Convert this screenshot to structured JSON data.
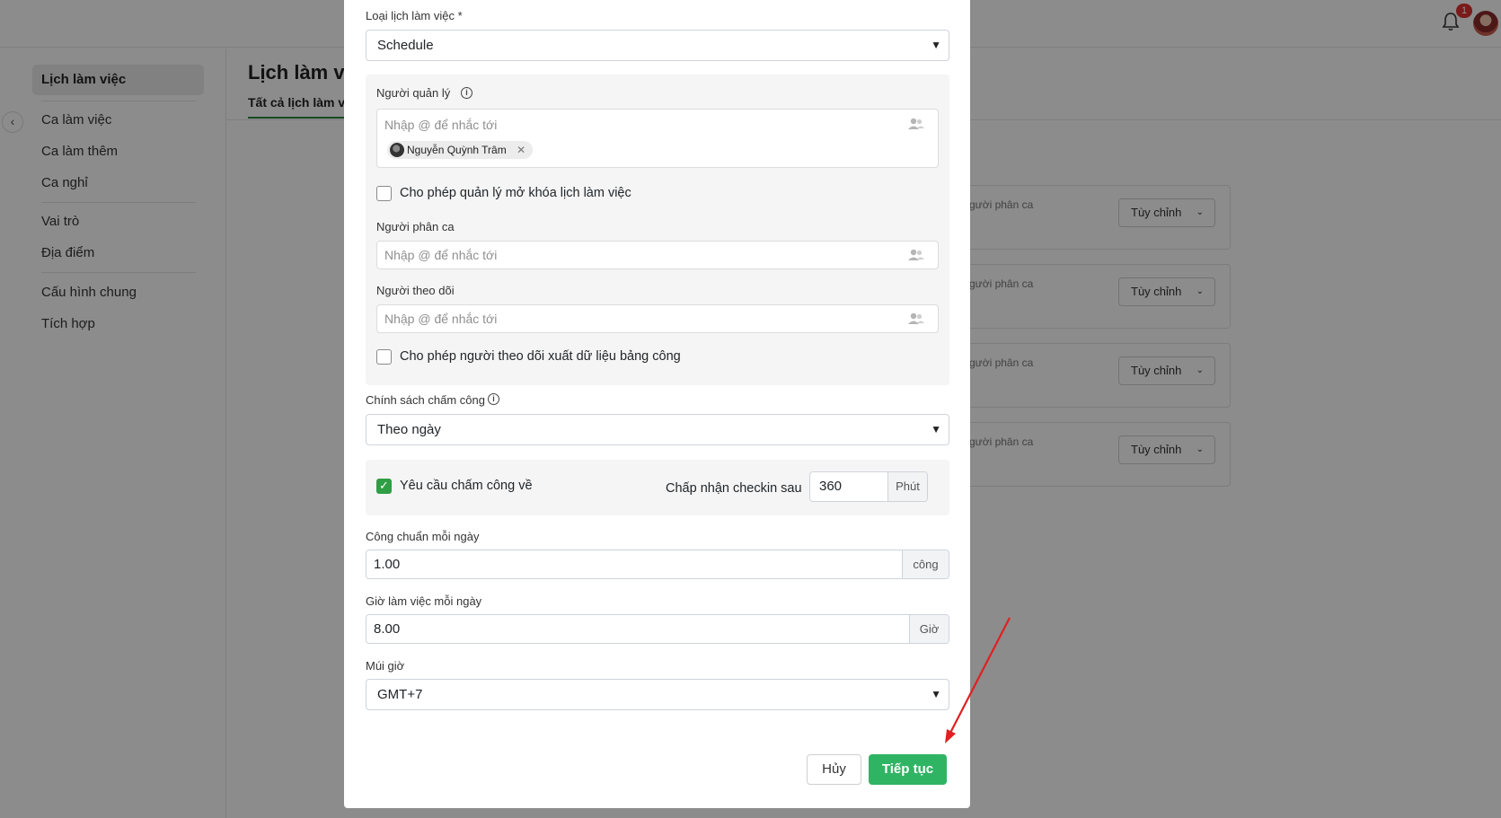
{
  "topbar": {
    "notification_count": "1"
  },
  "sidebar": {
    "items": [
      {
        "label": "Lịch làm việc",
        "active": true
      },
      {
        "label": "Ca làm việc"
      },
      {
        "label": "Ca làm thêm"
      },
      {
        "label": "Ca nghỉ"
      },
      {
        "label": "Vai trò"
      },
      {
        "label": "Địa điểm"
      },
      {
        "label": "Cấu hình chung"
      },
      {
        "label": "Tích hợp"
      }
    ]
  },
  "main": {
    "title": "Lịch làm vi",
    "tab": "Tất cả lịch làm v",
    "cards": [
      {
        "label": "gười phân ca",
        "button": "Tùy chỉnh"
      },
      {
        "label": "gười phân ca",
        "button": "Tùy chỉnh"
      },
      {
        "label": "gười phân ca",
        "button": "Tùy chỉnh"
      },
      {
        "label": "gười phân ca",
        "button": "Tùy chỉnh"
      }
    ]
  },
  "modal": {
    "schedule_type": {
      "label": "Loại lịch làm việc *",
      "value": "Schedule"
    },
    "managers": {
      "label": "Người quản lý",
      "placeholder": "Nhập @ để nhắc tới",
      "chips": [
        "Nguyễn Quỳnh Trâm"
      ]
    },
    "allow_manager_unlock": {
      "label": "Cho phép quản lý mở khóa lịch làm việc",
      "checked": false
    },
    "assigners": {
      "label": "Người phân ca",
      "placeholder": "Nhập @ để nhắc tới"
    },
    "followers": {
      "label": "Người theo dõi",
      "placeholder": "Nhập @ để nhắc tới"
    },
    "allow_follower_export": {
      "label": "Cho phép người theo dõi xuất dữ liệu bảng công",
      "checked": false
    },
    "attendance_policy": {
      "label": "Chính sách chấm công",
      "value": "Theo ngày"
    },
    "require_checkout": {
      "label": "Yêu cầu chấm công về",
      "checked": true
    },
    "checkin_after": {
      "label": "Chấp nhận checkin sau",
      "value": "360",
      "unit": "Phút"
    },
    "standard_per_day": {
      "label": "Công chuẩn mỗi ngày",
      "value": "1.00",
      "unit": "công"
    },
    "hours_per_day": {
      "label": "Giờ làm việc mỗi ngày",
      "value": "8.00",
      "unit": "Giờ"
    },
    "timezone": {
      "label": "Múi giờ",
      "value": "GMT+7"
    },
    "cancel_label": "Hủy",
    "next_label": "Tiếp tục"
  },
  "colors": {
    "primary": "#2fb464",
    "annotation_arrow": "#e02020"
  }
}
